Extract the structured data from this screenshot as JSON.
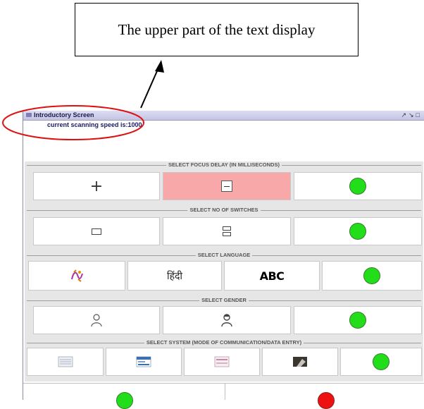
{
  "callout": {
    "text": "The upper part of the text display"
  },
  "window": {
    "title": "Introductory Screen",
    "buttons": "↗↘□",
    "speed_text": "current scanning speed is:1000"
  },
  "groups": {
    "focus_delay": {
      "label": "SELECT FOCUS DELAY (IN MILLISECONDS)"
    },
    "switches": {
      "label": "SELECT NO OF SWITCHES"
    },
    "language": {
      "label": "SELECT LANGUAGE",
      "hindi": "हिंदी",
      "english": "ABC"
    },
    "gender": {
      "label": "SELECT GENDER"
    },
    "system": {
      "label": "SELECT SYSTEM (MODE OF COMMUNICATION/DATA ENTRY)"
    }
  },
  "colors": {
    "go": "#22dd1a",
    "stop": "#ee1111",
    "selected": "#f8a8a8",
    "group_bg": "#e6e6e6",
    "annotation": "#dd1111"
  }
}
